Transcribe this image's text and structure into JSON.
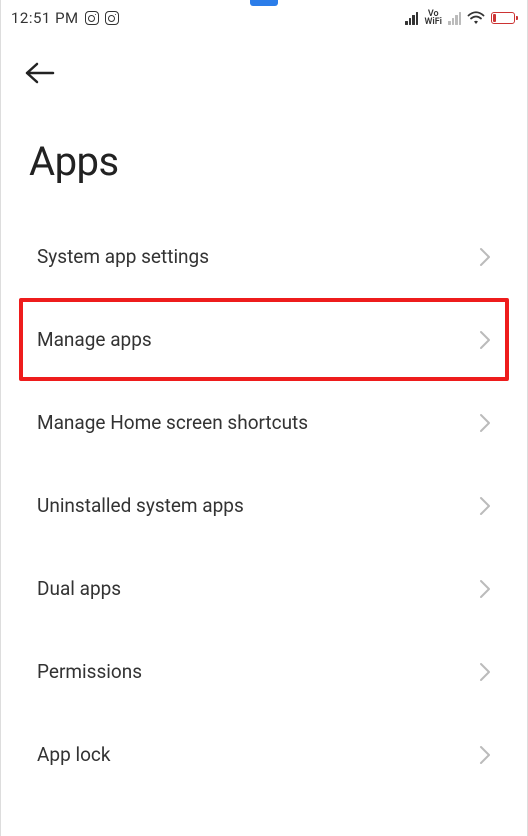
{
  "status": {
    "time": "12:51 PM",
    "vowifi_top": "Vo",
    "vowifi_bottom": "WiFi"
  },
  "page": {
    "title": "Apps"
  },
  "list": {
    "items": [
      {
        "label": "System app settings"
      },
      {
        "label": "Manage apps"
      },
      {
        "label": "Manage Home screen shortcuts"
      },
      {
        "label": "Uninstalled system apps"
      },
      {
        "label": "Dual apps"
      },
      {
        "label": "Permissions"
      },
      {
        "label": "App lock"
      }
    ],
    "highlighted_index": 1
  },
  "annotation": {
    "highlight_color": "#ee1c1c"
  }
}
